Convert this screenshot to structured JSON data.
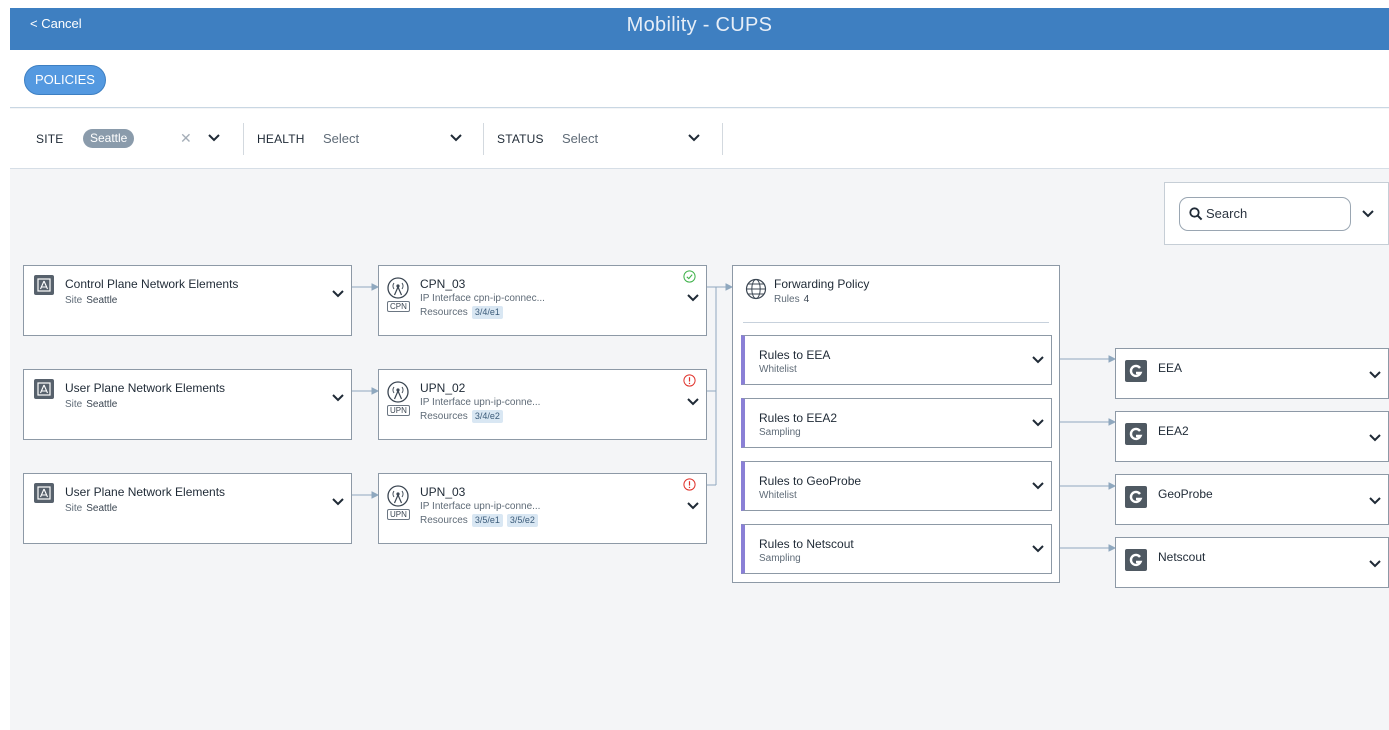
{
  "header": {
    "cancel_label": "< Cancel",
    "title": "Mobility - CUPS",
    "color": "#3e7fc1"
  },
  "toolbar": {
    "policies_label": "POLICIES"
  },
  "filters": {
    "site": {
      "label": "SITE",
      "value": "Seattle"
    },
    "health": {
      "label": "HEALTH",
      "placeholder": "Select"
    },
    "status": {
      "label": "STATUS",
      "placeholder": "Select"
    }
  },
  "search": {
    "placeholder": "Search"
  },
  "network_elements": [
    {
      "title": "Control Plane Network Elements",
      "site_label": "Site",
      "site": "Seattle"
    },
    {
      "title": "User Plane Network Elements",
      "site_label": "Site",
      "site": "Seattle"
    },
    {
      "title": "User Plane Network Elements",
      "site_label": "Site",
      "site": "Seattle"
    }
  ],
  "nodes": [
    {
      "name": "CPN_03",
      "badge": "CPN",
      "interface_label": "IP Interface",
      "interface": "cpn-ip-connec...",
      "resources_label": "Resources",
      "resources": [
        "3/4/e1"
      ],
      "status": "ok",
      "status_color": "#3fb24a"
    },
    {
      "name": "UPN_02",
      "badge": "UPN",
      "interface_label": "IP Interface",
      "interface": "upn-ip-conne...",
      "resources_label": "Resources",
      "resources": [
        "3/4/e2"
      ],
      "status": "error",
      "status_color": "#e0322b"
    },
    {
      "name": "UPN_03",
      "badge": "UPN",
      "interface_label": "IP Interface",
      "interface": "upn-ip-conne...",
      "resources_label": "Resources",
      "resources": [
        "3/5/e1",
        "3/5/e2"
      ],
      "status": "error",
      "status_color": "#e0322b"
    }
  ],
  "forwarding_policy": {
    "title": "Forwarding Policy",
    "rules_label": "Rules",
    "rules_count": "4",
    "rules": [
      {
        "name": "Rules to EEA",
        "type": "Whitelist"
      },
      {
        "name": "Rules to EEA2",
        "type": "Sampling"
      },
      {
        "name": "Rules to GeoProbe",
        "type": "Whitelist"
      },
      {
        "name": "Rules to Netscout",
        "type": "Sampling"
      }
    ],
    "rule_accent": "#8a80d6"
  },
  "targets": [
    {
      "name": "EEA"
    },
    {
      "name": "EEA2"
    },
    {
      "name": "GeoProbe"
    },
    {
      "name": "Netscout"
    }
  ]
}
